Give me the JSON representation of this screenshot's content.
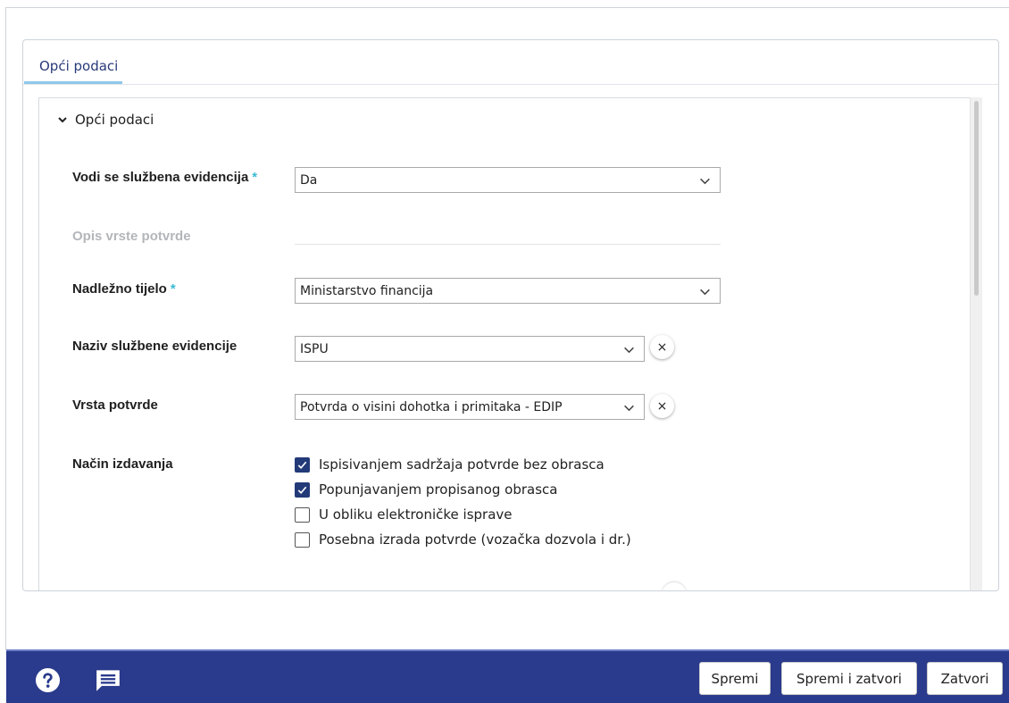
{
  "tab": {
    "label": "Opći podaci"
  },
  "section": {
    "title": "Opći podaci"
  },
  "fields": {
    "vodi": {
      "label": "Vodi se službena evidencija",
      "required": "*",
      "value": "Da"
    },
    "opis": {
      "label": "Opis vrste potvrde",
      "value": ""
    },
    "nadlezno": {
      "label": "Nadležno tijelo",
      "required": "*",
      "value": "Ministarstvo financija"
    },
    "naziv": {
      "label": "Naziv službene evidencije",
      "value": "ISPU"
    },
    "vrsta": {
      "label": "Vrsta potvrde",
      "value": "Potvrda o visini dohotka i primitaka - EDIP"
    },
    "nacin": {
      "label": "Način izdavanja",
      "options": [
        {
          "label": "Ispisivanjem sadržaja potvrde bez obrasca",
          "checked": true
        },
        {
          "label": "Popunjavanjem propisanog obrasca",
          "checked": true
        },
        {
          "label": "U obliku elektroničke isprave",
          "checked": false
        },
        {
          "label": "Posebna izrada potvrde (vozačka dozvola i dr.)",
          "checked": false
        }
      ]
    }
  },
  "clear_glyph": "×",
  "footer": {
    "help_icon": "help-circle-icon",
    "comment_icon": "comment-icon",
    "save_label": "Spremi",
    "save_close_label": "Spremi i zatvori",
    "close_label": "Zatvori"
  },
  "colors": {
    "accent": "#2a3a8c",
    "required": "#3bbbd6",
    "check": "#233a78",
    "tab_underline": "#8fc7ea"
  }
}
